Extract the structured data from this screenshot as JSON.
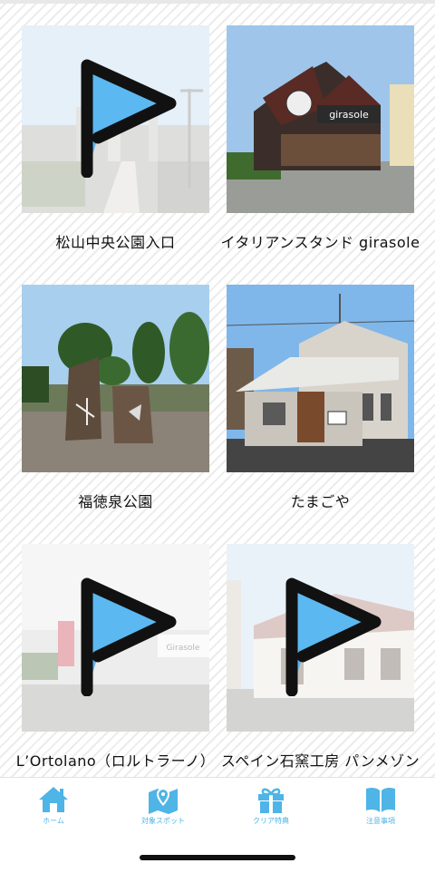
{
  "spots": [
    {
      "name": "松山中央公園入口",
      "visited": false,
      "scene": "park-entrance"
    },
    {
      "name": "イタリアンスタンド girasole",
      "visited": true,
      "scene": "restaurant"
    },
    {
      "name": "福徳泉公園",
      "visited": true,
      "scene": "spring-park"
    },
    {
      "name": "たまごや",
      "visited": true,
      "scene": "white-house"
    },
    {
      "name": "L’Ortolano（ロルトラーノ）",
      "visited": false,
      "scene": "ortolano"
    },
    {
      "name": "スペイン石窯工房 パンメゾン",
      "visited": false,
      "scene": "bakery"
    }
  ],
  "icons": {
    "unvisited_marker": "flag-icon"
  },
  "colors": {
    "accent": "#4fb4e6",
    "flag_fill": "#5bb8f0",
    "flag_outline": "#111111"
  },
  "tabbar": {
    "items": [
      {
        "label": "ホーム",
        "icon": "home-icon"
      },
      {
        "label": "対象スポット",
        "icon": "map-pin-icon"
      },
      {
        "label": "クリア特典",
        "icon": "gift-icon"
      },
      {
        "label": "注意事項",
        "icon": "book-icon"
      }
    ]
  }
}
